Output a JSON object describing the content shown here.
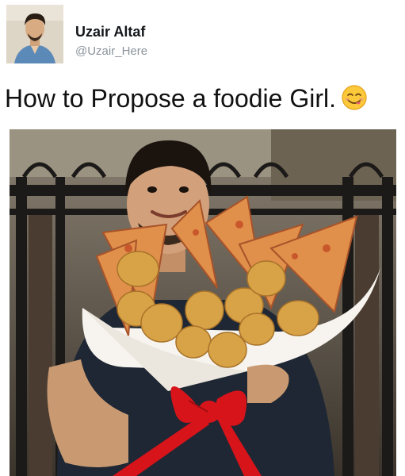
{
  "tweet": {
    "display_name": "Uzair Altaf",
    "handle": "@Uzair_Here",
    "text": "How to Propose a foodie Girl.",
    "emoji": "face-savoring-food-emoji"
  },
  "photo": {
    "icon": "pizza-nugget-bouquet-photo"
  },
  "colors": {
    "name": "#14171a",
    "handle": "#8a939b",
    "ribbon": "#d8141b",
    "pizza": "#e0904a"
  }
}
